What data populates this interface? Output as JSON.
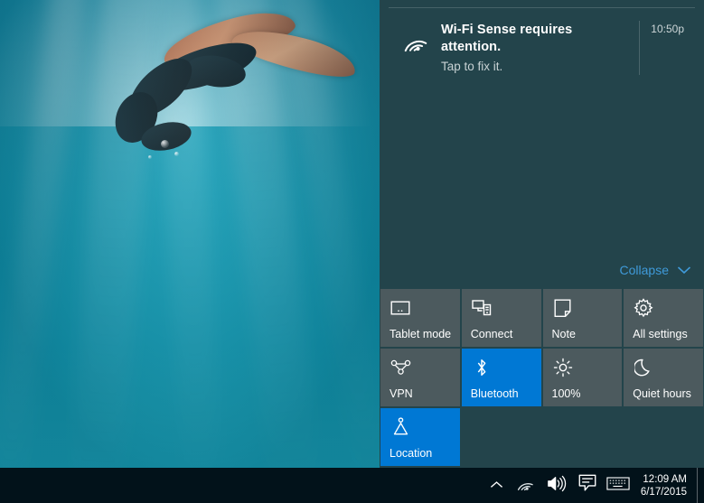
{
  "action_center": {
    "notifications": [
      {
        "icon": "wifi-sense-icon",
        "title": "Wi-Fi Sense requires attention.",
        "subtitle": "Tap to fix it.",
        "time": "10:50p"
      }
    ],
    "collapse": {
      "label": "Collapse",
      "icon": "chevron-down-icon",
      "color": "#3f9ad9"
    },
    "quick_actions": [
      {
        "icon": "tablet-icon",
        "label": "Tablet mode",
        "active": false
      },
      {
        "icon": "connect-icon",
        "label": "Connect",
        "active": false
      },
      {
        "icon": "note-icon",
        "label": "Note",
        "active": false
      },
      {
        "icon": "gear-icon",
        "label": "All settings",
        "active": false
      },
      {
        "icon": "vpn-icon",
        "label": "VPN",
        "active": false
      },
      {
        "icon": "bluetooth-icon",
        "label": "Bluetooth",
        "active": true
      },
      {
        "icon": "brightness-icon",
        "label": "100%",
        "active": false
      },
      {
        "icon": "moon-icon",
        "label": "Quiet hours",
        "active": false
      },
      {
        "icon": "location-icon",
        "label": "Location",
        "active": true
      }
    ],
    "colors": {
      "panel_background": "#23444b",
      "tile_background": "#4c5a5e",
      "tile_active": "#0078d4",
      "accent_link": "#3f9ad9"
    }
  },
  "taskbar": {
    "background": "#02121a",
    "tray_icons": [
      {
        "name": "show-hidden-icons-chevron-up-icon"
      },
      {
        "name": "network-wifi-icon"
      },
      {
        "name": "volume-speaker-icon"
      },
      {
        "name": "action-center-icon"
      },
      {
        "name": "touch-keyboard-icon"
      }
    ],
    "clock": {
      "time": "12:09 AM",
      "date": "6/17/2015"
    },
    "show_desktop": "show-desktop-button"
  },
  "desktop": {
    "wallpaper": "underwater-freediver-wallpaper"
  }
}
